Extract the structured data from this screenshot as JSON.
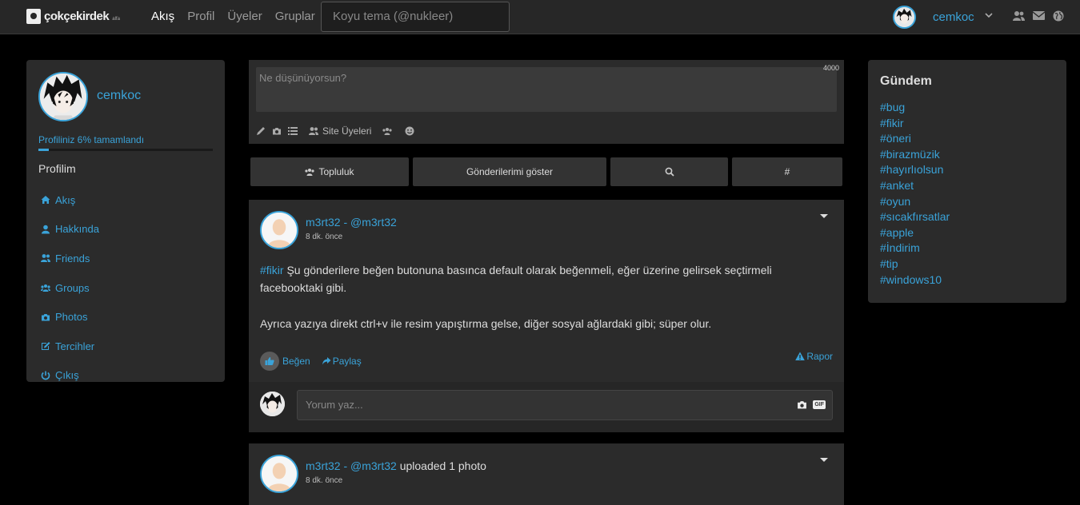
{
  "navbar": {
    "logo_text": "çokçekirdek",
    "logo_sup": "alfa",
    "links": [
      "Akış",
      "Profil",
      "Üyeler",
      "Gruplar"
    ],
    "active_link": "Akış",
    "search_placeholder": "Koyu tema (@nukleer)",
    "username": "cemkoc",
    "icons": [
      "users-icon",
      "envelope-icon",
      "globe-icon"
    ]
  },
  "left": {
    "username": "cemkoc",
    "profile_completion_text": "Profiliniz 6% tamamlandı",
    "profile_completion": 0.06,
    "section_title": "Profilim",
    "menu": [
      {
        "label": "Akış",
        "icon": "home-icon"
      },
      {
        "label": "Hakkında",
        "icon": "user-icon"
      },
      {
        "label": "Friends",
        "icon": "friends-icon"
      },
      {
        "label": "Groups",
        "icon": "groups-icon"
      },
      {
        "label": "Photos",
        "icon": "camera-icon"
      },
      {
        "label": "Tercihler",
        "icon": "edit-icon"
      },
      {
        "label": "Çıkış",
        "icon": "power-icon"
      }
    ]
  },
  "composer": {
    "placeholder": "Ne düşünüyorsun?",
    "char_limit": "4000",
    "audience_label": "Site Üyeleri"
  },
  "filters": {
    "community": "Topluluk",
    "my_posts": "Gönderilerimi göster",
    "search_icon": "search-icon",
    "hashtag": "#"
  },
  "posts": [
    {
      "author": "m3rt32 - @m3rt32",
      "suffix": "",
      "time": "8 dk. önce",
      "hashtag": "#fikir",
      "paragraph1": " Şu gönderilere beğen butonuna basınca default olarak beğenmeli, eğer üzerine gelirsek seçtirmeli facebooktaki gibi.",
      "paragraph2": "Ayrıca yazıya direkt ctrl+v ile resim yapıştırma gelse, diğer sosyal ağlardaki gibi; süper olur.",
      "like_label": "Beğen",
      "share_label": "Paylaş",
      "report_label": "Rapor",
      "comment_placeholder": "Yorum yaz...",
      "gif_label": "GIF"
    },
    {
      "author": "m3rt32 - @m3rt32",
      "suffix": "uploaded 1 photo",
      "time": "8 dk. önce"
    }
  ],
  "trending": {
    "title": "Gündem",
    "tags": [
      "#bug",
      "#fikir",
      "#öneri",
      "#birazmüzik",
      "#hayırlıolsun",
      "#anket",
      "#oyun",
      "#sıcakfırsatlar",
      "#apple",
      "#İndirim",
      "#tip",
      "#windows10"
    ]
  },
  "colors": {
    "accent": "#3aa3d9",
    "background": "#000000",
    "panel": "#2b2b2b",
    "navbar": "#272727"
  }
}
